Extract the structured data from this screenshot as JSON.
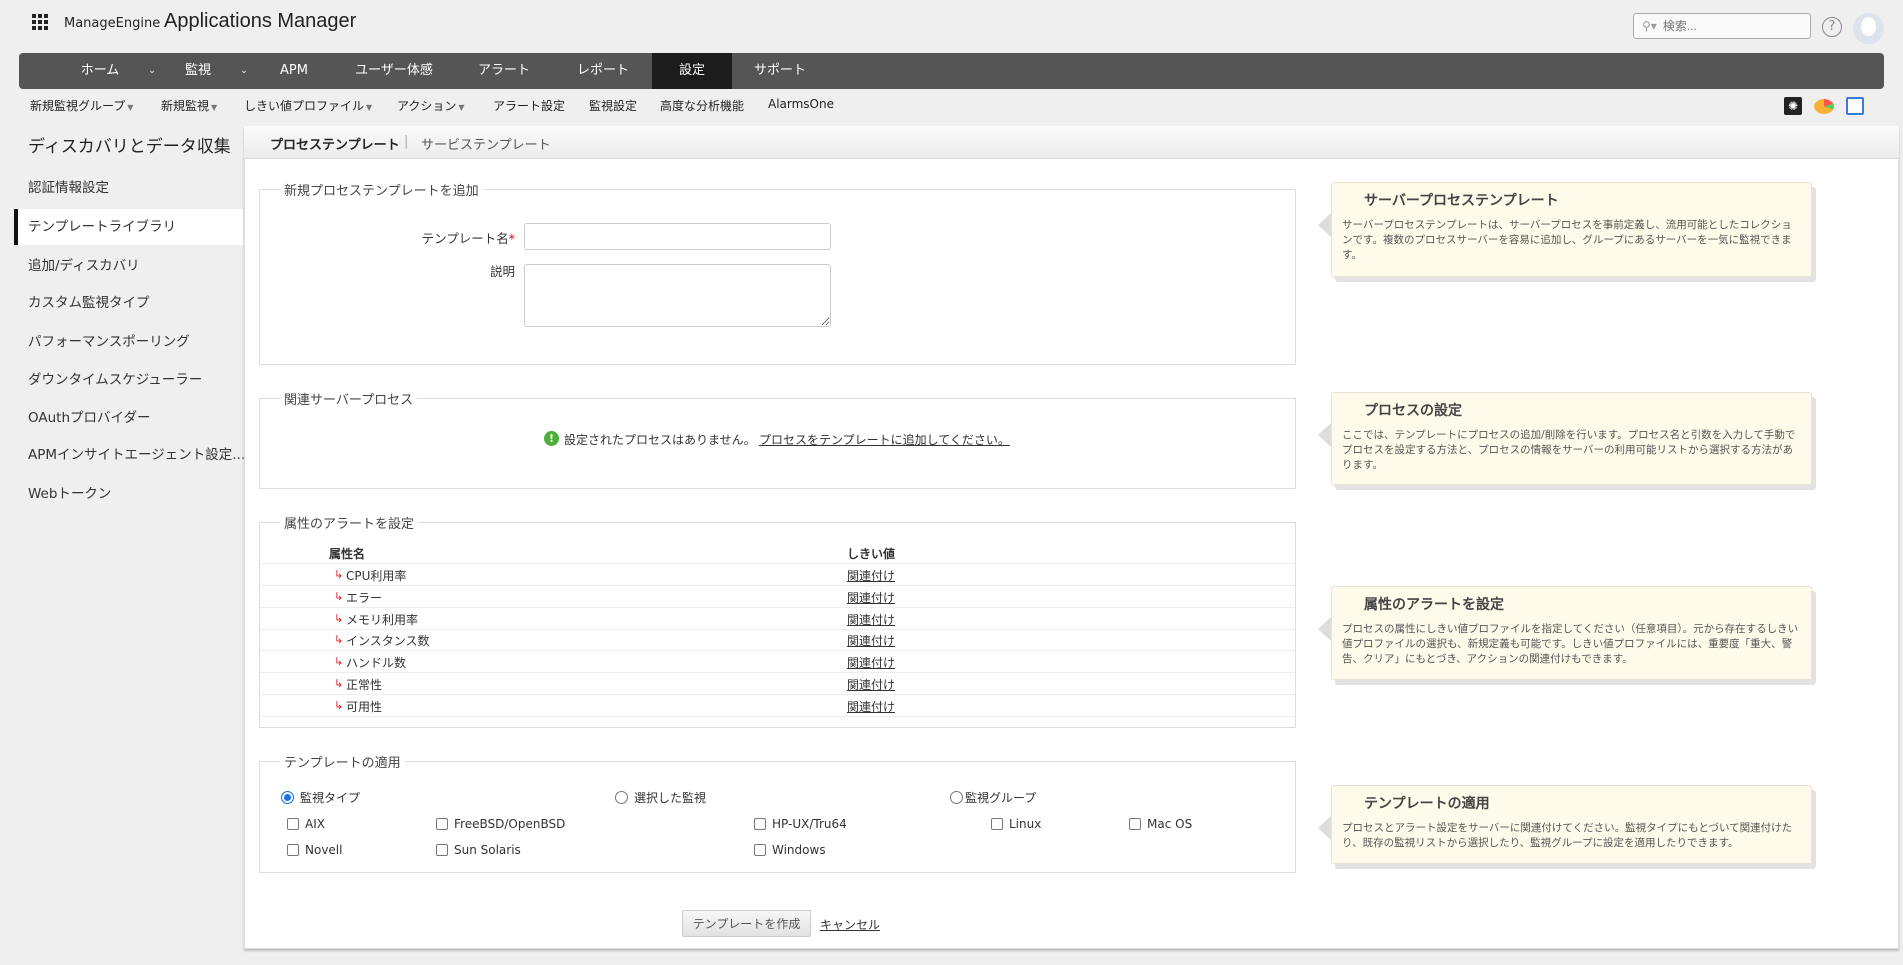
{
  "header": {
    "logo_brand": "ManageEngine",
    "logo_product": "Applications Manager",
    "search_placeholder": "検索...",
    "help": "?"
  },
  "nav": {
    "items": [
      "ホーム",
      "監視",
      "APM",
      "ユーザー体感",
      "アラート",
      "レポート",
      "設定",
      "サポート"
    ],
    "active": "設定"
  },
  "subnav": {
    "items": [
      "新規監視グループ",
      "新規監視",
      "しきい値プロファイル",
      "アクション",
      "アラート設定",
      "監視設定",
      "高度な分析機能",
      "AlarmsOne"
    ]
  },
  "sidebar": {
    "title": "ディスカバリとデータ収集",
    "items": [
      "認証情報設定",
      "テンプレートライブラリ",
      "追加/ディスカバリ",
      "カスタム監視タイプ",
      "パフォーマンスポーリング",
      "ダウンタイムスケジューラー",
      "OAuthプロバイダー",
      "APMインサイトエージェント設定...",
      "Webトークン"
    ],
    "active": "テンプレートライブラリ"
  },
  "tabs": {
    "active": "プロセステンプレート",
    "sep": "|",
    "other": "サービステンプレート"
  },
  "form": {
    "add": {
      "legend": "新規プロセステンプレートを追加",
      "name_label": "テンプレート名",
      "required": "*",
      "desc_label": "説明",
      "name_value": "",
      "desc_value": ""
    },
    "proc": {
      "legend": "関連サーバープロセス",
      "message": "設定されたプロセスはありません。",
      "link": "プロセスをテンプレートに追加してください。"
    },
    "alerts": {
      "legend": "属性のアラートを設定",
      "col_name": "属性名",
      "col_threshold": "しきい値",
      "rows": [
        {
          "name": "CPU利用率",
          "action": "関連付け"
        },
        {
          "name": "エラー",
          "action": "関連付け"
        },
        {
          "name": "メモリ利用率",
          "action": "関連付け"
        },
        {
          "name": "インスタンス数",
          "action": "関連付け"
        },
        {
          "name": "ハンドル数",
          "action": "関連付け"
        },
        {
          "name": "正常性",
          "action": "関連付け"
        },
        {
          "name": "可用性",
          "action": "関連付け"
        }
      ]
    },
    "apply": {
      "legend": "テンプレートの適用",
      "radios": [
        "監視タイプ",
        "選択した監視",
        "監視グループ"
      ],
      "selected": "監視タイプ",
      "types": [
        "AIX",
        "FreeBSD/OpenBSD",
        "HP-UX/Tru64",
        "Linux",
        "Mac OS",
        "Novell",
        "Sun Solaris",
        "Windows"
      ]
    },
    "create_button": "テンプレートを作成",
    "cancel_link": "キャンセル"
  },
  "help": [
    {
      "title": "サーバープロセステンプレート",
      "body": "サーバープロセステンプレートは、サーバープロセスを事前定義し、流用可能としたコレクションです。複数のプロセスサーバーを容易に追加し、グループにあるサーバーを一気に監視できます。"
    },
    {
      "title": "プロセスの設定",
      "body": "ここでは、テンプレートにプロセスの追加/削除を行います。プロセス名と引数を入力して手動でプロセスを設定する方法と、プロセスの情報をサーバーの利用可能リストから選択する方法があります。"
    },
    {
      "title": "属性のアラートを設定",
      "body": "プロセスの属性にしきい値プロファイルを指定してください（任意項目）。元から存在するしきい値プロファイルの選択も、新規定義も可能です。しきい値プロファイルには、重要度「重大、警告、クリア」にもとづき、アクションの関連付けもできます。"
    },
    {
      "title": "テンプレートの適用",
      "body": "プロセスとアラート設定をサーバーに関連付けてください。監視タイプにもとづいて関連付けたり、既存の監視リストから選択したり、監視グループに設定を適用したりできます。"
    }
  ]
}
